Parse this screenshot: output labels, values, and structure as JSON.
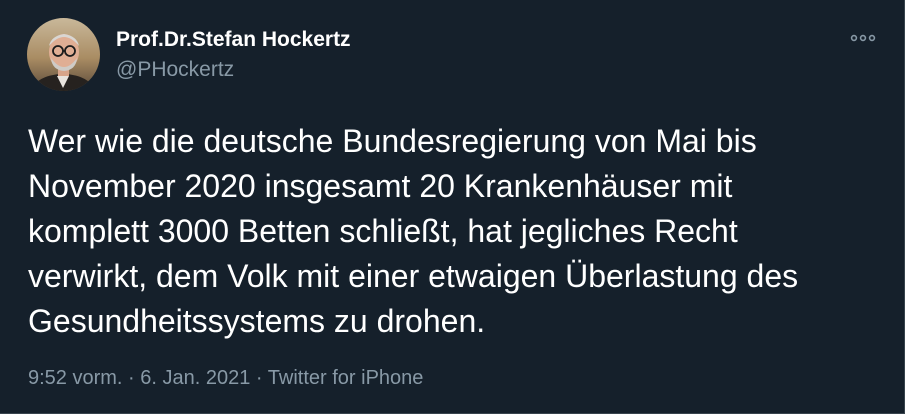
{
  "tweet": {
    "author": {
      "display_name": "Prof.Dr.Stefan Hockertz",
      "handle": "@PHockertz"
    },
    "more_icon": "more-horizontal-icon",
    "text": "Wer wie die deutsche Bundesregierung von Mai bis\nNovember 2020 insgesamt 20 Krankenhäuser mit\nkomplett 3000 Betten schließt, hat jegliches Recht\nverwirkt, dem Volk mit einer etwaigen Überlastung des\nGesundheitssystems zu drohen.",
    "meta": {
      "time": "9:52 vorm.",
      "separator1": " · ",
      "date": "6. Jan. 2021",
      "separator2": " · ",
      "source": "Twitter for iPhone"
    }
  },
  "colors": {
    "background": "#15202b",
    "primary_text": "#ffffff",
    "secondary_text": "#8899a6",
    "border": "#38444d"
  }
}
